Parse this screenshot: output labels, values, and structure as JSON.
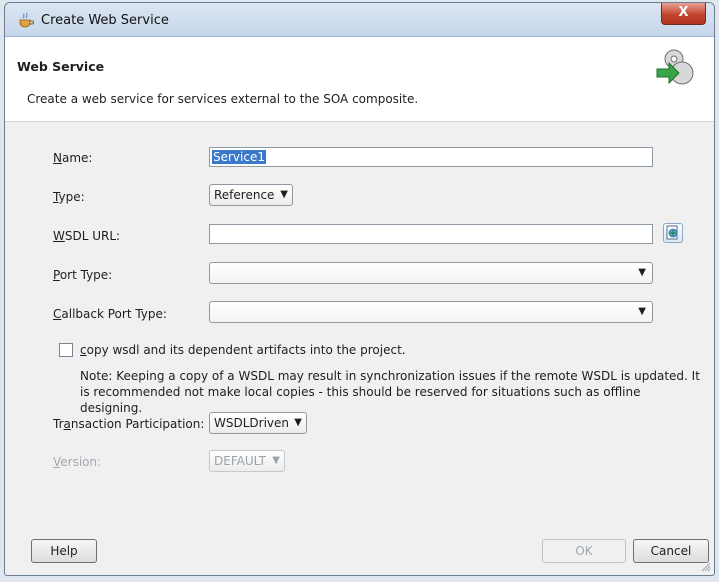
{
  "window": {
    "title": "Create Web Service",
    "close_label": "X"
  },
  "header": {
    "title": "Web Service",
    "description": "Create a web service for services external to the SOA composite.",
    "icon": "gear-arrow-icon"
  },
  "form": {
    "name": {
      "label_key": "N",
      "label_rest": "ame:",
      "value": "Service1"
    },
    "type": {
      "label_key": "T",
      "label_rest": "ype:",
      "value": "Reference"
    },
    "wsdl_url": {
      "label_key": "W",
      "label_rest": "SDL URL:",
      "value": ""
    },
    "port_type": {
      "label_key": "P",
      "label_rest": "ort Type:",
      "value": ""
    },
    "callback_port_type": {
      "label_key": "C",
      "label_rest": "allback Port Type:",
      "value": ""
    },
    "copy_wsdl": {
      "label_key": "c",
      "label_rest": "opy wsdl and its dependent artifacts into the project.",
      "checked": false
    },
    "note": "Note: Keeping a copy of a WSDL may result in synchronization issues if the remote WSDL is updated. It is recommended not make local copies - this should be reserved for situations such as offline designing.",
    "transaction": {
      "label_pre": "Tr",
      "label_key": "a",
      "label_rest": "nsaction Participation:",
      "value": "WSDLDriven"
    },
    "version": {
      "label_key": "V",
      "label_rest": "ersion:",
      "value": "DEFAULT"
    }
  },
  "buttons": {
    "help": "Help",
    "ok": "OK",
    "cancel": "Cancel"
  },
  "colors": {
    "selection": "#3a78c9",
    "close": "#c2452f"
  }
}
